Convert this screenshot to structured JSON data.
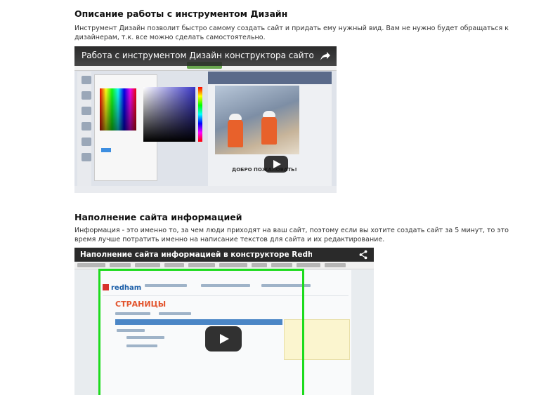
{
  "sections": [
    {
      "title": "Описание работы с инструментом Дизайн",
      "description": "Инструмент Дизайн позволит быстро самому создать сайт и придать ему нужный вид. Вам не нужно будет обращаться к дизайнерам, т.к. все можно сделать самостоятельно.",
      "video": {
        "title": "Работа с инструментом Дизайн конструктора сайтов Red...",
        "embedded_heading": "ДОБРО ПОЖАЛОВАТЬ!"
      }
    },
    {
      "title": "Наполнение сайта информацией",
      "description": "Информация - это именно то, за чем люди приходят на ваш сайт, поэтому если вы хотите создать сайт за 5 минут, то это время лучше потратить именно на написание текстов для сайта и их редактирование.",
      "video": {
        "title": "Наполнение сайта информацией в конструкторе Redham",
        "embedded_logo": "redham",
        "embedded_heading": "СТРАНИЦЫ"
      }
    }
  ],
  "icons": {
    "play": "play-icon",
    "share": "share-icon"
  },
  "colors": {
    "video_titlebar": "#2b2b2b",
    "highlight_frame": "#1ddb1d",
    "embedded_heading": "#e2542d"
  }
}
